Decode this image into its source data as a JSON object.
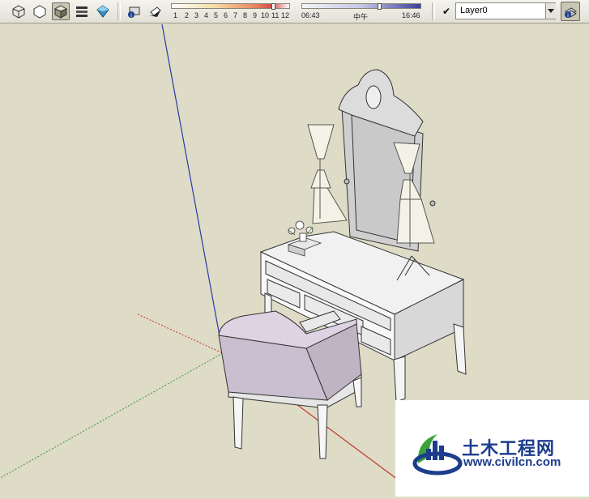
{
  "toolbar": {
    "style_buttons": [
      {
        "icon": "xray-style-icon",
        "active": false
      },
      {
        "icon": "wireframe-style-icon",
        "active": false
      },
      {
        "icon": "shaded-style-icon",
        "active": true
      },
      {
        "icon": "shaded-textures-style-icon",
        "active": false
      },
      {
        "icon": "monochrome-style-icon",
        "active": false
      }
    ],
    "shadow_buttons": [
      {
        "icon": "shadow-settings-icon"
      },
      {
        "icon": "display-shadows-icon"
      }
    ],
    "month_ticks": [
      "1",
      "2",
      "3",
      "4",
      "5",
      "6",
      "7",
      "8",
      "9",
      "10",
      "11",
      "12"
    ],
    "month_value": 11,
    "time_start": "06:43",
    "time_noon": "中午",
    "time_end": "16:46"
  },
  "layers": {
    "current": "Layer0",
    "check": "✔"
  },
  "scene": {
    "axis_colors": {
      "blue": "#2a3aa8",
      "red": "#c0392b",
      "green": "#3a9a3a"
    },
    "background": "#dedbc6"
  },
  "watermark": {
    "title": "土木工程网",
    "url": "www.civilcn.com",
    "brand_blue": "#1c3d8c",
    "brand_green": "#3aa33a"
  }
}
